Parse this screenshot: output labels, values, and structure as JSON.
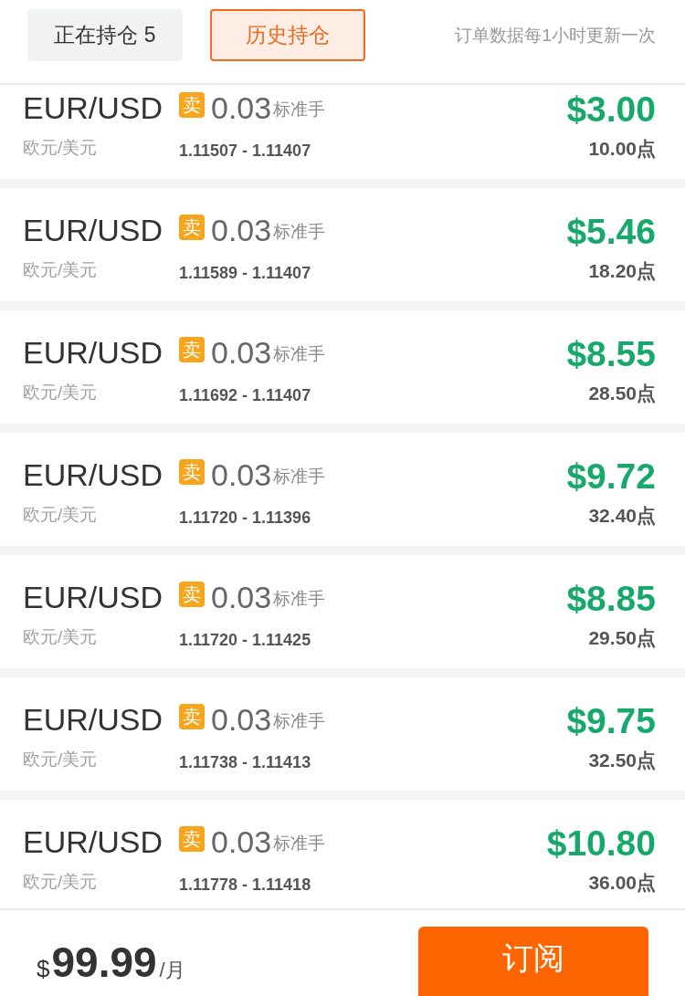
{
  "header": {
    "tabs": [
      {
        "label": "正在持仓 5",
        "selected": false
      },
      {
        "label": "历史持仓",
        "selected": true
      }
    ],
    "note": "订单数据每1小时更新一次"
  },
  "orders": [
    {
      "symbol": "EUR/USD",
      "name": "欧元/美元",
      "side": "卖",
      "lots": "0.03",
      "lot_unit": "标准手",
      "price_range": "1.11507 - 1.11407",
      "profit": "$3.00",
      "points": "10.00点"
    },
    {
      "symbol": "EUR/USD",
      "name": "欧元/美元",
      "side": "卖",
      "lots": "0.03",
      "lot_unit": "标准手",
      "price_range": "1.11589 - 1.11407",
      "profit": "$5.46",
      "points": "18.20点"
    },
    {
      "symbol": "EUR/USD",
      "name": "欧元/美元",
      "side": "卖",
      "lots": "0.03",
      "lot_unit": "标准手",
      "price_range": "1.11692 - 1.11407",
      "profit": "$8.55",
      "points": "28.50点"
    },
    {
      "symbol": "EUR/USD",
      "name": "欧元/美元",
      "side": "卖",
      "lots": "0.03",
      "lot_unit": "标准手",
      "price_range": "1.11720 - 1.11396",
      "profit": "$9.72",
      "points": "32.40点"
    },
    {
      "symbol": "EUR/USD",
      "name": "欧元/美元",
      "side": "卖",
      "lots": "0.03",
      "lot_unit": "标准手",
      "price_range": "1.11720 - 1.11425",
      "profit": "$8.85",
      "points": "29.50点"
    },
    {
      "symbol": "EUR/USD",
      "name": "欧元/美元",
      "side": "卖",
      "lots": "0.03",
      "lot_unit": "标准手",
      "price_range": "1.11738 - 1.11413",
      "profit": "$9.75",
      "points": "32.50点"
    },
    {
      "symbol": "EUR/USD",
      "name": "欧元/美元",
      "side": "卖",
      "lots": "0.03",
      "lot_unit": "标准手",
      "price_range": "1.11778 - 1.11418",
      "profit": "$10.80",
      "points": "36.00点"
    }
  ],
  "footer": {
    "currency": "$",
    "price": "99.99",
    "period": "/月",
    "button": "订阅"
  }
}
